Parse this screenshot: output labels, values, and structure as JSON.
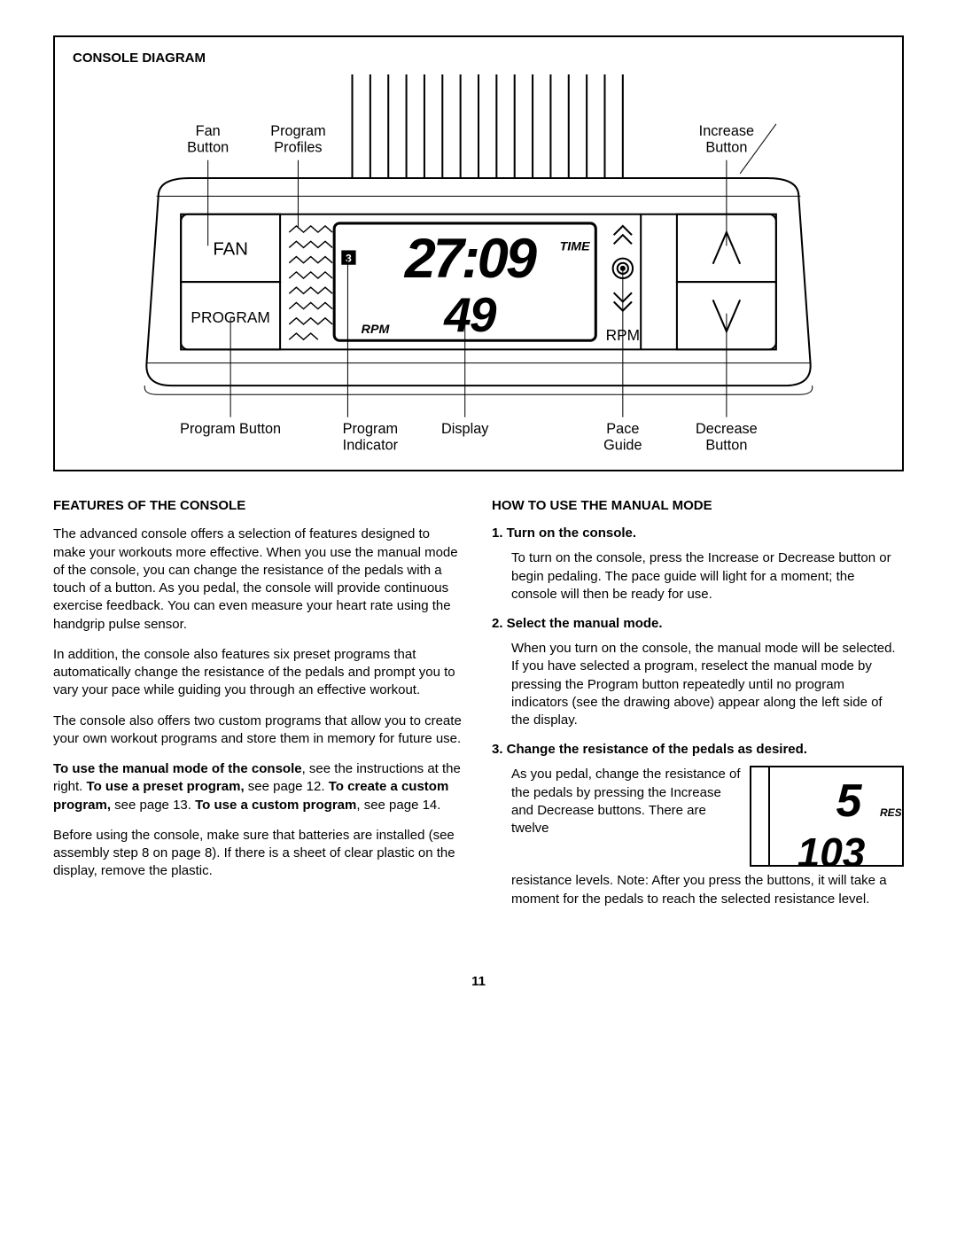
{
  "diagram": {
    "title": "CONSOLE DIAGRAM",
    "labels": {
      "fan_button": "Fan\nButton",
      "program_profiles": "Program\nProfiles",
      "increase_button": "Increase\nButton",
      "fan": "FAN",
      "program": "PROGRAM",
      "rpm": "RPM",
      "time_small": "TIME",
      "rpm_small": "RPM",
      "program_button": "Program Button",
      "program_indicator": "Program\nIndicator",
      "display": "Display",
      "pace_guide": "Pace\nGuide",
      "decrease_button": "Decrease\nButton",
      "display_time": "27:09",
      "display_rpm": "49",
      "level_indicator": "3"
    }
  },
  "left": {
    "heading": "FEATURES OF THE CONSOLE",
    "p1": "The advanced console offers a selection of features designed to make your workouts more effective. When you use the manual mode of the console, you can change the resistance of the pedals with a touch of a button. As you pedal, the console will provide continuous exercise feedback. You can even measure your heart rate using the handgrip pulse sensor.",
    "p2": "In addition, the console also features six preset programs that automatically change the resistance of the pedals and prompt you to vary your pace while guiding you through an effective workout.",
    "p3": "The console also offers two custom programs that allow you to create your own workout programs and store them in memory for future use.",
    "p4_a": "To use the manual mode of the console",
    "p4_b": ", see the instructions at the right. ",
    "p4_c": "To use a preset program,",
    "p4_d": " see page 12. ",
    "p4_e": "To create a custom program,",
    "p4_f": " see page 13. ",
    "p4_g": "To use a custom program",
    "p4_h": ", see page 14.",
    "p5": "Before using the console, make sure that batteries are installed (see assembly step 8 on page 8). If there is a sheet of clear plastic on the display, remove the plastic."
  },
  "right": {
    "heading": "HOW TO USE THE MANUAL MODE",
    "step1_title": "1.  Turn on the console.",
    "step1_text": "To turn on the console, press the Increase or Decrease button or begin pedaling. The pace guide will light for a moment; the console will then be ready for use.",
    "step2_title": "2.  Select the manual mode.",
    "step2_text": "When you turn on the console, the manual mode will be selected. If you have selected a program, reselect the manual mode by pressing the Program button repeatedly until no program indicators (see the drawing above) appear along the left side of the display.",
    "step3_title": "3.  Change the resistance of the pedals as desired.",
    "step3_text_a": "As you pedal, change the resistance of the pedals by pressing the Increase and Decrease buttons. There are twelve",
    "step3_text_b": "resistance levels. Note: After you press the buttons, it will take a moment for the pedals to reach the selected resistance level.",
    "resist_label": "RESIST.",
    "resist_val": "5",
    "resist_secondary": "103"
  },
  "page_number": "11"
}
